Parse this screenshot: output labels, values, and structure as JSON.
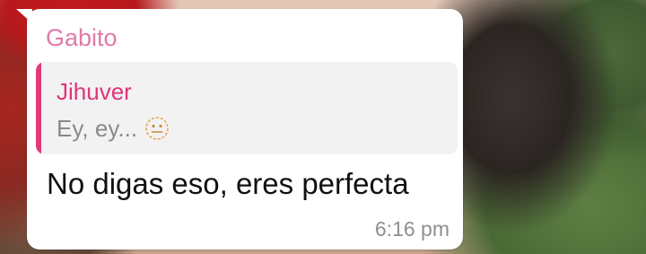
{
  "message": {
    "sender": "Gabito",
    "reply": {
      "author": "Jihuver",
      "text": "Ey, ey...",
      "emoji": "neutral-face-icon"
    },
    "text": "No digas eso, eres perfecta",
    "time": "6:16 pm"
  },
  "colors": {
    "sender": "#e07aa9",
    "reply_author": "#e2337a",
    "reply_bar": "#e33a7a",
    "bubble": "#ffffff"
  }
}
